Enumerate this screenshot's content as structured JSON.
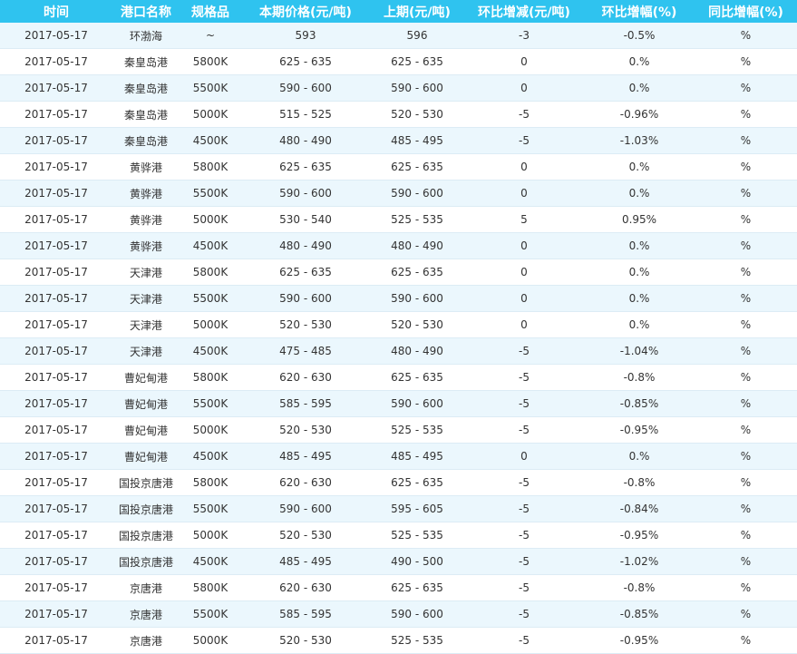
{
  "table": {
    "columns": [
      "时间",
      "港口名称",
      "规格品",
      "本期价格(元/吨)",
      "上期(元/吨)",
      "环比增减(元/吨)",
      "环比增幅(%)",
      "同比增幅(%)"
    ],
    "rows": [
      [
        "2017-05-17",
        "环渤海",
        "~",
        "593",
        "596",
        "-3",
        "-0.5%",
        "%"
      ],
      [
        "2017-05-17",
        "秦皇岛港",
        "5800K",
        "625 - 635",
        "625 - 635",
        "0",
        "0.%",
        "%"
      ],
      [
        "2017-05-17",
        "秦皇岛港",
        "5500K",
        "590 - 600",
        "590 - 600",
        "0",
        "0.%",
        "%"
      ],
      [
        "2017-05-17",
        "秦皇岛港",
        "5000K",
        "515 - 525",
        "520 - 530",
        "-5",
        "-0.96%",
        "%"
      ],
      [
        "2017-05-17",
        "秦皇岛港",
        "4500K",
        "480 - 490",
        "485 - 495",
        "-5",
        "-1.03%",
        "%"
      ],
      [
        "2017-05-17",
        "黄骅港",
        "5800K",
        "625 - 635",
        "625 - 635",
        "0",
        "0.%",
        "%"
      ],
      [
        "2017-05-17",
        "黄骅港",
        "5500K",
        "590 - 600",
        "590 - 600",
        "0",
        "0.%",
        "%"
      ],
      [
        "2017-05-17",
        "黄骅港",
        "5000K",
        "530 - 540",
        "525 - 535",
        "5",
        "0.95%",
        "%"
      ],
      [
        "2017-05-17",
        "黄骅港",
        "4500K",
        "480 - 490",
        "480 - 490",
        "0",
        "0.%",
        "%"
      ],
      [
        "2017-05-17",
        "天津港",
        "5800K",
        "625 - 635",
        "625 - 635",
        "0",
        "0.%",
        "%"
      ],
      [
        "2017-05-17",
        "天津港",
        "5500K",
        "590 - 600",
        "590 - 600",
        "0",
        "0.%",
        "%"
      ],
      [
        "2017-05-17",
        "天津港",
        "5000K",
        "520 - 530",
        "520 - 530",
        "0",
        "0.%",
        "%"
      ],
      [
        "2017-05-17",
        "天津港",
        "4500K",
        "475 - 485",
        "480 - 490",
        "-5",
        "-1.04%",
        "%"
      ],
      [
        "2017-05-17",
        "曹妃甸港",
        "5800K",
        "620 - 630",
        "625 - 635",
        "-5",
        "-0.8%",
        "%"
      ],
      [
        "2017-05-17",
        "曹妃甸港",
        "5500K",
        "585 - 595",
        "590 - 600",
        "-5",
        "-0.85%",
        "%"
      ],
      [
        "2017-05-17",
        "曹妃甸港",
        "5000K",
        "520 - 530",
        "525 - 535",
        "-5",
        "-0.95%",
        "%"
      ],
      [
        "2017-05-17",
        "曹妃甸港",
        "4500K",
        "485 - 495",
        "485 - 495",
        "0",
        "0.%",
        "%"
      ],
      [
        "2017-05-17",
        "国投京唐港",
        "5800K",
        "620 - 630",
        "625 - 635",
        "-5",
        "-0.8%",
        "%"
      ],
      [
        "2017-05-17",
        "国投京唐港",
        "5500K",
        "590 - 600",
        "595 - 605",
        "-5",
        "-0.84%",
        "%"
      ],
      [
        "2017-05-17",
        "国投京唐港",
        "5000K",
        "520 - 530",
        "525 - 535",
        "-5",
        "-0.95%",
        "%"
      ],
      [
        "2017-05-17",
        "国投京唐港",
        "4500K",
        "485 - 495",
        "490 - 500",
        "-5",
        "-1.02%",
        "%"
      ],
      [
        "2017-05-17",
        "京唐港",
        "5800K",
        "620 - 630",
        "625 - 635",
        "-5",
        "-0.8%",
        "%"
      ],
      [
        "2017-05-17",
        "京唐港",
        "5500K",
        "585 - 595",
        "590 - 600",
        "-5",
        "-0.85%",
        "%"
      ],
      [
        "2017-05-17",
        "京唐港",
        "5000K",
        "520 - 530",
        "525 - 535",
        "-5",
        "-0.95%",
        "%"
      ]
    ]
  },
  "colors": {
    "header_bg": "#2fc3ef",
    "header_text": "#ffffff",
    "row_alt_bg": "#ebf7fd",
    "row_bg": "#ffffff",
    "cell_text": "#333333"
  }
}
